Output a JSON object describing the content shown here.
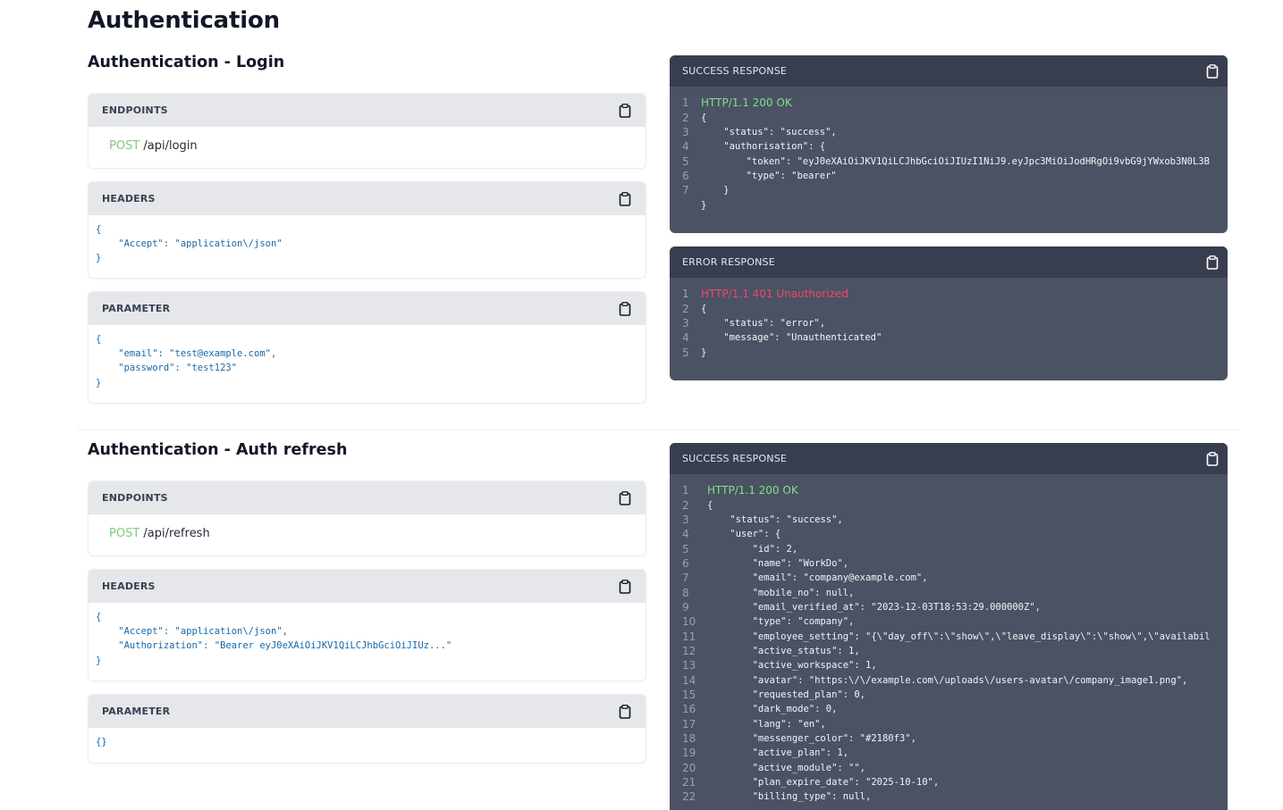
{
  "page": {
    "title": "Authentication"
  },
  "icons": {
    "copy": "clipboard-icon"
  },
  "colors": {
    "method": "#7fc97f",
    "status_ok": "#7ee08a",
    "status_error": "#f0476a",
    "code": "#1769aa"
  },
  "sections": [
    {
      "title": "Authentication - Login",
      "endpoints_label": "ENDPOINTS",
      "method": "POST",
      "path": "/api/login",
      "headers_label": "HEADERS",
      "headers_code": "{\n    \"Accept\": \"application\\/json\"\n}",
      "parameter_label": "PARAMETER",
      "parameter_code": "{\n    \"email\": \"test@example.com\",\n    \"password\": \"test123\"\n}",
      "success_label": "SUCCESS RESPONSE",
      "success_lines": [
        {
          "n": "1",
          "t": "HTTP/1.1 200 OK"
        },
        {
          "n": "2",
          "t": "{"
        },
        {
          "n": "3",
          "t": "    \"status\": \"success\","
        },
        {
          "n": "4",
          "t": "    \"authorisation\": {"
        },
        {
          "n": "5",
          "t": "        \"token\": \"eyJ0eXAiOiJKV1QiLCJhbGciOiJIUzI1NiJ9.eyJpc3MiOiJodHRgOi9vbG9jYWxob3N0L3B"
        },
        {
          "n": "6",
          "t": "        \"type\": \"bearer\""
        },
        {
          "n": "7",
          "t": "    }"
        },
        {
          "n": "",
          "t": "}"
        }
      ],
      "error_label": "ERROR RESPONSE",
      "error_lines": [
        {
          "n": "1",
          "t": "HTTP/1.1 401 Unauthorized"
        },
        {
          "n": "2",
          "t": "{"
        },
        {
          "n": "3",
          "t": "    \"status\": \"error\","
        },
        {
          "n": "4",
          "t": "    \"message\": \"Unauthenticated\""
        },
        {
          "n": "5",
          "t": "}"
        }
      ]
    },
    {
      "title": "Authentication - Auth refresh",
      "endpoints_label": "ENDPOINTS",
      "method": "POST",
      "path": "/api/refresh",
      "headers_label": "HEADERS",
      "headers_code": "{\n    \"Accept\": \"application\\/json\",\n    \"Authorization\": \"Bearer eyJ0eXAiOiJKV1QiLCJhbGciOiJIUz...\"\n}",
      "parameter_label": "PARAMETER",
      "parameter_code": "{}",
      "success_label": "SUCCESS RESPONSE",
      "success_lines": [
        {
          "n": "1",
          "t": "HTTP/1.1 200 OK"
        },
        {
          "n": "2",
          "t": "{"
        },
        {
          "n": "3",
          "t": "    \"status\": \"success\","
        },
        {
          "n": "4",
          "t": "    \"user\": {"
        },
        {
          "n": "5",
          "t": "        \"id\": 2,"
        },
        {
          "n": "6",
          "t": "        \"name\": \"WorkDo\","
        },
        {
          "n": "7",
          "t": "        \"email\": \"company@example.com\","
        },
        {
          "n": "8",
          "t": "        \"mobile_no\": null,"
        },
        {
          "n": "9",
          "t": "        \"email_verified_at\": \"2023-12-03T18:53:29.000000Z\","
        },
        {
          "n": "10",
          "t": "        \"type\": \"company\","
        },
        {
          "n": "11",
          "t": "        \"employee_setting\": \"{\\\"day_off\\\":\\\"show\\\",\\\"leave_display\\\":\\\"show\\\",\\\"availabil"
        },
        {
          "n": "12",
          "t": "        \"active_status\": 1,"
        },
        {
          "n": "13",
          "t": "        \"active_workspace\": 1,"
        },
        {
          "n": "14",
          "t": "        \"avatar\": \"https:\\/\\/example.com\\/uploads\\/users-avatar\\/company_image1.png\","
        },
        {
          "n": "15",
          "t": "        \"requested_plan\": 0,"
        },
        {
          "n": "16",
          "t": "        \"dark_mode\": 0,"
        },
        {
          "n": "17",
          "t": "        \"lang\": \"en\","
        },
        {
          "n": "18",
          "t": "        \"messenger_color\": \"#2180f3\","
        },
        {
          "n": "19",
          "t": "        \"active_plan\": 1,"
        },
        {
          "n": "20",
          "t": "        \"active_module\": \"\","
        },
        {
          "n": "21",
          "t": "        \"plan_expire_date\": \"2025-10-10\","
        },
        {
          "n": "22",
          "t": "        \"billing_type\": null,"
        }
      ]
    }
  ]
}
